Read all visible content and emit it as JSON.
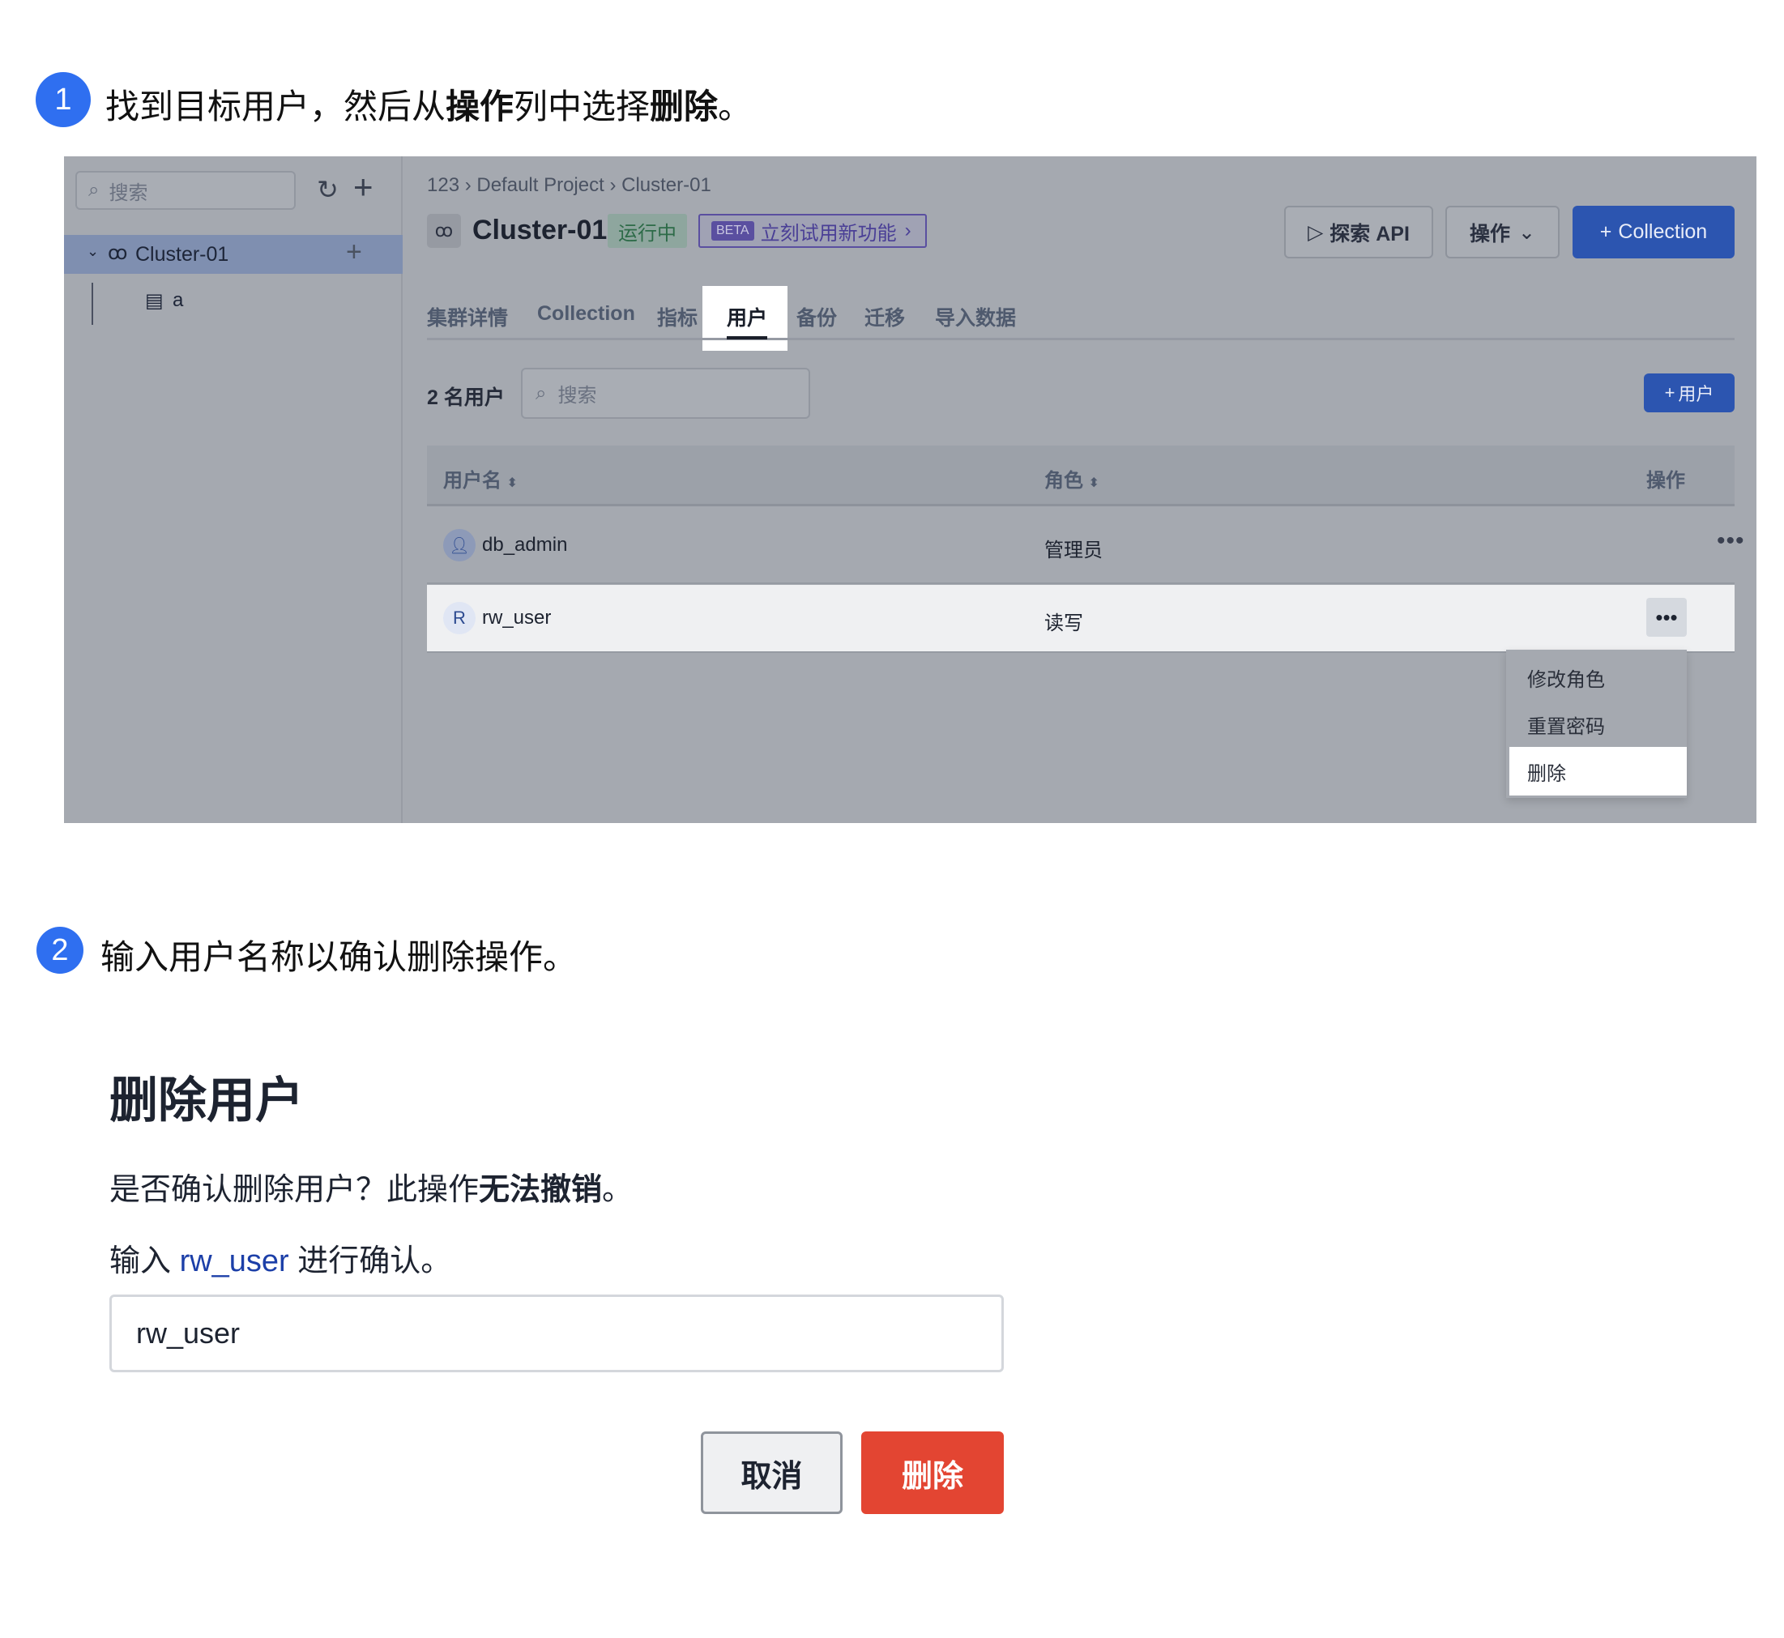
{
  "step1": {
    "number": "1",
    "text_parts": [
      "找到目标用户，然后从",
      "操作",
      "列中选择",
      "删除",
      "。"
    ]
  },
  "step2": {
    "number": "2",
    "text": "输入用户名称以确认删除操作。"
  },
  "app": {
    "sidebar": {
      "search_placeholder": "搜索",
      "tree": [
        {
          "label": "Cluster-01",
          "children": [
            {
              "label": "a"
            }
          ]
        }
      ]
    },
    "breadcrumb": [
      "123",
      "Default Project",
      "Cluster-01"
    ],
    "title": "Cluster-01",
    "status_badge": "运行中",
    "beta": {
      "tag": "BETA",
      "label": "立刻试用新功能"
    },
    "buttons": {
      "explore_api": "探索 API",
      "actions": "操作",
      "add_collection": "Collection",
      "add_user": "用户"
    },
    "tabs": [
      "集群详情",
      "Collection",
      "指标",
      "用户",
      "备份",
      "迁移",
      "导入数据"
    ],
    "active_tab": "用户",
    "user_count": "2 名用户",
    "search_placeholder": "搜索",
    "table": {
      "columns": [
        "用户名",
        "角色",
        "操作"
      ],
      "rows": [
        {
          "avatar": "person-icon",
          "username": "db_admin",
          "role": "管理员"
        },
        {
          "avatar": "R",
          "username": "rw_user",
          "role": "读写"
        }
      ]
    },
    "menu": [
      "修改角色",
      "重置密码",
      "删除"
    ],
    "colors": {
      "primary": "#2c55b0",
      "overlay": "#a5a9b0",
      "beta": "#5a4fa0"
    }
  },
  "dialog": {
    "title": "删除用户",
    "message_parts": [
      "是否确认删除用户？此操作",
      "无法撤销",
      "。"
    ],
    "confirm_parts": [
      "输入 ",
      "rw_user",
      " 进行确认。"
    ],
    "input_value": "rw_user",
    "cancel": "取消",
    "delete": "删除",
    "colors": {
      "danger": "#e34532",
      "link": "#1c3fa8"
    }
  }
}
